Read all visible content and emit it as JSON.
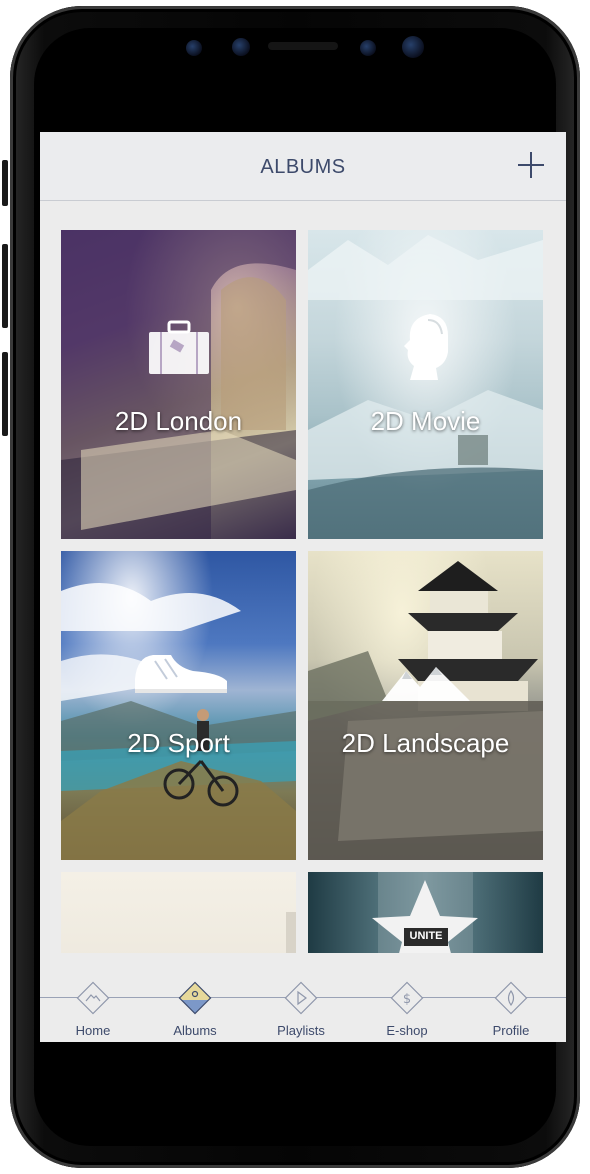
{
  "header": {
    "title": "ALBUMS"
  },
  "albums": [
    {
      "label": "2D London"
    },
    {
      "label": "2D Movie"
    },
    {
      "label": "2D Sport"
    },
    {
      "label": "2D Landscape"
    },
    {
      "label": ""
    },
    {
      "label": "UNITE"
    }
  ],
  "tabs": [
    {
      "label": "Home",
      "icon": "mountain-icon",
      "active": false
    },
    {
      "label": "Albums",
      "icon": "landscape-icon",
      "active": true
    },
    {
      "label": "Playlists",
      "icon": "play-icon",
      "active": false
    },
    {
      "label": "E-shop",
      "icon": "dollar-icon",
      "active": false
    },
    {
      "label": "Profile",
      "icon": "drop-icon",
      "active": false
    }
  ],
  "colors": {
    "accent": "#3d4a6b",
    "active_tab_fill": "#e6d89a",
    "active_tab_lower": "#7c98c8"
  }
}
